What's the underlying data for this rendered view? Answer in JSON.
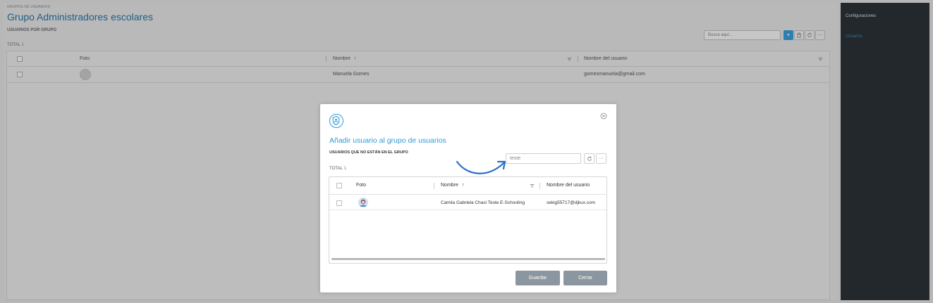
{
  "header": {
    "eyebrow": "GRUPOS DE USUARIOS",
    "title": "Grupo Administradores escolares",
    "subtitle": "USUARIOS POR GRUPO",
    "total_label": "TOTAL",
    "total_count": "1"
  },
  "toolbar": {
    "search_placeholder": "Busca aquí...",
    "add_icon": "plus-icon",
    "delete_icon": "trash-icon",
    "refresh_icon": "refresh-icon",
    "more_label": "···"
  },
  "table": {
    "columns": [
      "Foto",
      "Nombre",
      "Nombre del usuario"
    ],
    "sort_arrow": "↑",
    "rows": [
      {
        "nombre": "Manuela Gomes",
        "usuario": "gomesmanuela@gmail.com"
      }
    ]
  },
  "sidebar": {
    "items": [
      {
        "label": "Configuraciones"
      },
      {
        "label": "Usuarios"
      }
    ]
  },
  "modal": {
    "title": "Añadir usuario al grupo de usuarios",
    "subtitle": "USUARIOS QUE NO ESTÁN EN EL GRUPO",
    "total_label": "TOTAL",
    "total_count": "1",
    "search_value": "teste",
    "refresh_icon": "refresh-icon",
    "more_label": "···",
    "columns": [
      "Foto",
      "Nombre",
      "Nombre del usuario"
    ],
    "sort_arrow": "↑",
    "rows": [
      {
        "nombre": "Camila Gabriela Chasi Teste E-Schooling",
        "usuario": "sekig55717@djkux.com"
      }
    ],
    "save_label": "Guardar",
    "close_label": "Cerrar"
  },
  "colors": {
    "accent": "#2f9ad6",
    "sidebar_bg": "#23282d",
    "button_gray": "#8b96a0"
  }
}
